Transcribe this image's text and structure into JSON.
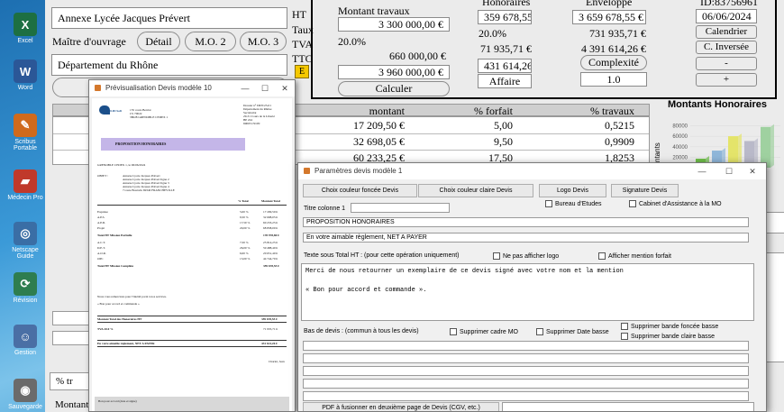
{
  "desktop": {
    "icons": [
      {
        "label": "Excel",
        "icon": "excel-icon",
        "glyph": "X",
        "color": "#1d6f42"
      },
      {
        "label": "Word",
        "icon": "word-icon",
        "glyph": "W",
        "color": "#2b5797"
      },
      {
        "label": "Scribus Portable",
        "icon": "pen-icon",
        "glyph": "✎",
        "color": "#d06a1c"
      },
      {
        "label": "Médecin Pro",
        "icon": "medical-icon",
        "glyph": "▰",
        "color": "#c0392b"
      },
      {
        "label": "Netscape Guide",
        "icon": "globe-icon",
        "glyph": "◎",
        "color": "#3a6ea5"
      },
      {
        "label": "Révision",
        "icon": "refresh-icon",
        "glyph": "⟳",
        "color": "#2e7d4f"
      },
      {
        "label": "Gestion",
        "icon": "person-icon",
        "glyph": "☺",
        "color": "#4a6fa5"
      },
      {
        "label": "Sauvegarde",
        "icon": "disk-icon",
        "glyph": "◉",
        "color": "#6b6b6b"
      }
    ]
  },
  "form": {
    "client_name": "Annexe Lycée Jacques Prévert",
    "maitre_label": "Maître d'ouvrage",
    "detail_button": "Détail",
    "mo2_button": "M.O. 2",
    "mo3_button": "M.O. 3",
    "departement": "Département du Rhône",
    "ht_label": "HT",
    "taux_label": "Taux",
    "tva_label": "TVA",
    "ttc_label": "TTC",
    "e_badge": "E",
    "montant_travaux_label": "Montant travaux",
    "montant_travaux_value": "3 300 000,00 €",
    "tva_rate": "20.0%",
    "tva_amount": "660 000,00 €",
    "ttc_amount": "3 960 000,00 €",
    "calculer_button": "Calculer",
    "honoraires_label": "Honoraires",
    "honoraires_ht": "359 678,55 €",
    "honoraires_rate": "20.0%",
    "honoraires_tva": "71 935,71 €",
    "honoraires_ttc": "431 614,26 €",
    "affaire_button": "Affaire",
    "enveloppe_label": "Enveloppe",
    "enveloppe_ht": "3 659 678,55 €",
    "enveloppe_tva": "731 935,71 €",
    "enveloppe_ttc": "4 391 614,26 €",
    "complexite_button": "Complexité",
    "complexite_value": "1.0",
    "id_label": "ID:83756961",
    "date_value": "06/06/2024",
    "calendrier_button": "Calendrier",
    "cinversee_button": "C. Inversée",
    "minus_button": "-",
    "plus_button": "+",
    "table": {
      "headers": [
        "montant",
        "% forfait",
        "% travaux"
      ],
      "rows": [
        [
          "17 209,50 €",
          "5,00",
          "0,5215"
        ],
        [
          "32 698,05 €",
          "9,50",
          "0,9909"
        ],
        [
          "60 233,25 €",
          "17,50",
          "1,8253"
        ]
      ]
    },
    "bottom_label_pct": "% tr",
    "bottom_label_montant": "Montant",
    "chart": {
      "title": "Montants Honoraires",
      "ylabel": "ntants",
      "ticks": [
        "80000",
        "60000",
        "40000",
        "20000"
      ],
      "bar_colors": [
        "#6fbf4a",
        "#8fb6d9",
        "#e4e46a",
        "#b9b9c9",
        "#9fd1a0"
      ]
    }
  },
  "chart_data": {
    "type": "bar",
    "title": "Montants Honoraires",
    "ylabel": "ntants",
    "ylim": [
      0,
      100000
    ],
    "ticks": [
      80000,
      60000,
      40000,
      20000
    ],
    "values": [
      17209.5,
      32698.05,
      60233.25,
      51000,
      78000
    ]
  },
  "preview": {
    "title": "Prévisualisation Devis modèle 10",
    "logo_text": "SOLID Soft",
    "sender_lines": [
      "155 cours Berriat",
      "CS 70022",
      "38028 GRENOBLE CEDEX 1"
    ],
    "recipient_lines": [
      "Dossier n° DP/0/23-01",
      "Département du Rhône",
      "Secrétariat",
      "29-31 Cours de la Liberté",
      "BP 224",
      "69003 LYON"
    ],
    "banner": "PROPOSITION HONORAIRES",
    "date_line": "GRENOBLE CEDEX 1, le 06/06/2024",
    "objet_label": "OBJET :",
    "objet_lines": [
      "Annexe Lycée Jacques Prévert",
      "Annexe Lycée Jacques Prévert ligne 2",
      "Annexe Lycée Jacques Prévert ligne 3",
      "Annexe Lycée Jacques Prévert ligne 4",
      "7 route Boutwin 69340 FRANCHEVILLE"
    ],
    "col_taux": "% Total",
    "col_montant": "Montant Total",
    "rows": [
      {
        "label": "Esquisse",
        "pct": "5,00 %",
        "amount": "17 209,50 €"
      },
      {
        "label": "A.P.S.",
        "pct": "9,50 %",
        "amount": "32 698,05 €"
      },
      {
        "label": "A.P.D.",
        "pct": "17,50 %",
        "amount": "60 233,25 €"
      },
      {
        "label": "Projet",
        "pct": "20,00 %",
        "amount": "68 838,00 €"
      }
    ],
    "subtotal1": {
      "label": "Total HT Mission Partielle",
      "amount": "178 978,80 €"
    },
    "rows2": [
      {
        "label": "A.C.T.",
        "pct": "7,50 %",
        "amount": "25 814,25 €"
      },
      {
        "label": "D.E.T.",
        "pct": "26,00 %",
        "amount": "59 488,40 €"
      },
      {
        "label": "A.O.R.",
        "pct": "6,00 %",
        "amount": "20 651,40 €"
      },
      {
        "label": "OPC",
        "pct": "13,00 %",
        "amount": "44 744,70 €"
      }
    ],
    "subtotal2": {
      "label": "Total HT Mission Complète",
      "amount": "359 678,55 €"
    },
    "note1": "Nous vous remercions pour l'intérêt porté à nos services.",
    "note2": "« Bon pour accord et commande »",
    "total_ht_label": "Montant Total des Honoraires HT",
    "total_ht": "359 678,55 €",
    "tva_label": "TVA 20.0 %",
    "tva_amount": "71 935,71 €",
    "ttc_label": "En votre aimable règlement, NET A PAYER",
    "ttc_amount": "431 614,26 €",
    "signature": "Charlet, Jean",
    "footer": "Bon pour accord (date et signe)"
  },
  "dialog": {
    "title": "Paramètres devis modèle 1",
    "btn_dark_color": "Choix couleur foncée Devis",
    "btn_light_color": "Choix couleur claire Devis",
    "btn_logo": "Logo Devis",
    "btn_signature": "Signature Devis",
    "cb_bureau": "Bureau d'Etudes",
    "cb_cabinet": "Cabinet d'Assistance à la MO",
    "titre_colonne_label": "Titre colonne 1",
    "field_proposition": "PROPOSITION HONORAIRES",
    "field_net": "En votre aimable règlement, NET A PAYER",
    "texte_label": "Texte sous Total HT :  (pour cette opération uniquement)",
    "cb_logo": "Ne pas afficher logo",
    "cb_forfait": "Afficher mention forfait",
    "textarea_line1": "Merci de nous retourner un exemplaire de ce devis signé avec votre nom et la mention",
    "textarea_line2": "« Bon pour accord et commande ».",
    "bas_label": "Bas de devis : (commun à tous les devis)",
    "cb_cadre": "Supprimer cadre MO",
    "cb_date": "Supprimer Date basse",
    "cb_bande_foncee": "Supprimer bande foncée basse",
    "cb_bande_claire": "Supprimer bande claire basse",
    "pdf_button": "PDF à fusionner en deuxième page de Devis (CGV, etc.)"
  }
}
